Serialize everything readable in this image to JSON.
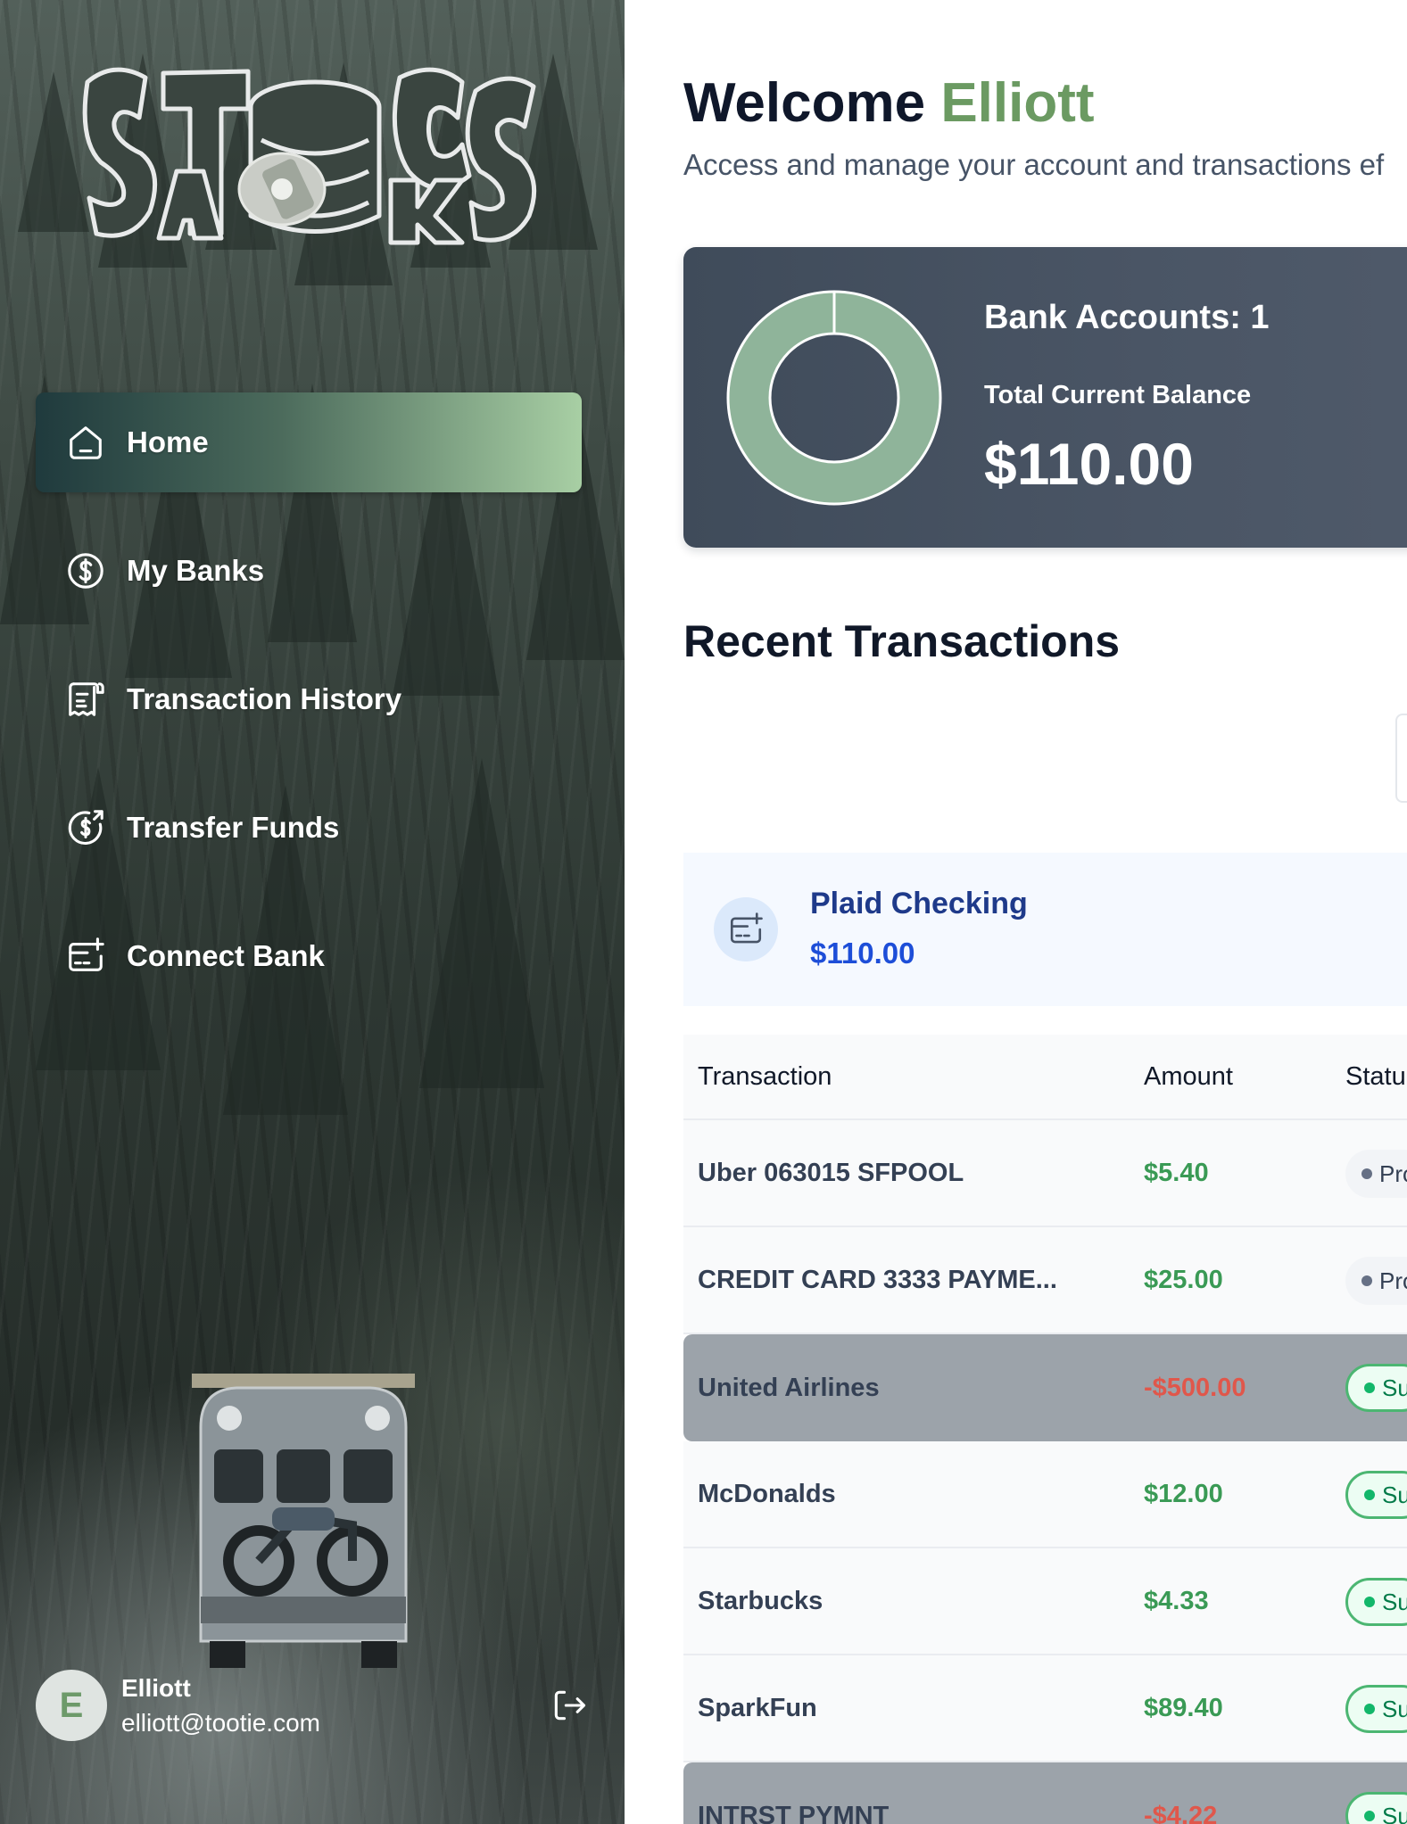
{
  "brand": {
    "logo_text": "STACKS",
    "colors": {
      "accent": "#6b9a62",
      "active_nav": "#a8cfa4",
      "card": "#4a5565"
    }
  },
  "sidebar": {
    "items": [
      {
        "label": "Home",
        "icon": "home-icon",
        "active": true
      },
      {
        "label": "My Banks",
        "icon": "dollar-circle-icon",
        "active": false
      },
      {
        "label": "Transaction History",
        "icon": "receipt-icon",
        "active": false
      },
      {
        "label": "Transfer Funds",
        "icon": "money-send-icon",
        "active": false
      },
      {
        "label": "Connect Bank",
        "icon": "card-add-icon",
        "active": false
      }
    ],
    "user": {
      "initial": "E",
      "name": "Elliott",
      "email": "elliott@tootie.com",
      "logout_icon": "logout-icon"
    }
  },
  "header": {
    "greeting": "Welcome",
    "name": "Elliott",
    "subtitle": "Access and manage your account and transactions ef"
  },
  "balance": {
    "accounts_label": "Bank Accounts: 1",
    "total_label": "Total Current Balance",
    "total_value": "$110.00"
  },
  "recent": {
    "title": "Recent Transactions",
    "bank_tab": {
      "icon": "card-add-icon",
      "name": "Plaid Checking",
      "balance": "$110.00"
    },
    "table": {
      "headers": [
        "Transaction",
        "Amount",
        "Statu"
      ],
      "rows": [
        {
          "name": "Uber 063015 SFPOOL",
          "amount": "$5.40",
          "status": "Pro",
          "status_type": "processing",
          "highlight": false
        },
        {
          "name": "CREDIT CARD 3333 PAYME...",
          "amount": "$25.00",
          "status": "Pro",
          "status_type": "processing",
          "highlight": false
        },
        {
          "name": "United Airlines",
          "amount": "-$500.00",
          "status": "Su",
          "status_type": "success",
          "highlight": true
        },
        {
          "name": "McDonalds",
          "amount": "$12.00",
          "status": "Su",
          "status_type": "success",
          "highlight": false
        },
        {
          "name": "Starbucks",
          "amount": "$4.33",
          "status": "Su",
          "status_type": "success",
          "highlight": false
        },
        {
          "name": "SparkFun",
          "amount": "$89.40",
          "status": "Su",
          "status_type": "success",
          "highlight": false
        },
        {
          "name": "INTRST PYMNT",
          "amount": "-$4.22",
          "status": "Su",
          "status_type": "success",
          "highlight": true
        }
      ]
    }
  }
}
